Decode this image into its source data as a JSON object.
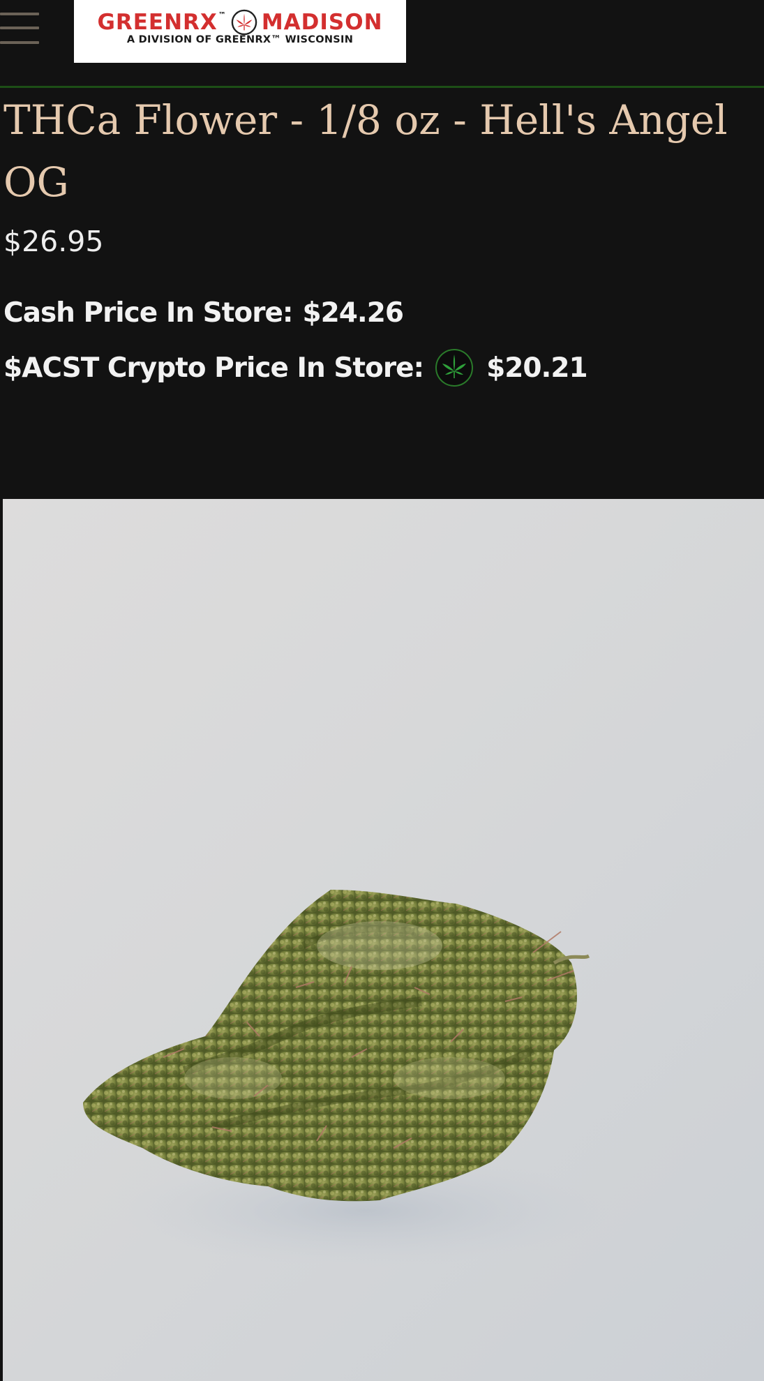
{
  "header": {
    "menu_icon": "hamburger-menu-icon",
    "logo": {
      "brand_left": "GREENRX",
      "tm": "™",
      "brand_right": "MADISON",
      "tagline": "A DIVISION OF GREENRX™ WISCONSIN",
      "leaf_icon": "cannabis-leaf-icon",
      "brand_color": "#d32f2f"
    },
    "border_color": "#1d4f16"
  },
  "product": {
    "title": "THCa Flower - 1/8 oz - Hell's Angel OG",
    "price": "$26.95",
    "cash_label": "Cash Price In Store:",
    "cash_value": "$24.26",
    "crypto_label": "$ACST Crypto Price In Store:",
    "crypto_icon": "acst-token-icon",
    "crypto_value": "$20.21",
    "title_color": "#e5c9ae",
    "image_subject": "product-photo"
  }
}
